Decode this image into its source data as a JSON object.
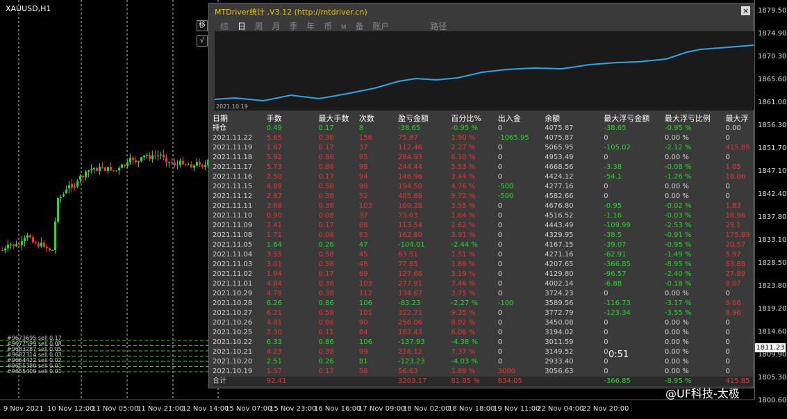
{
  "window": {
    "symbol": "XAUUSD,H1"
  },
  "chart_buttons": [
    "移",
    "√"
  ],
  "price_axis": [
    "1879.50",
    "1874.90",
    "1870.30",
    "1865.60",
    "1861.00",
    "1856.30",
    "1851.70",
    "1847.10",
    "1842.40",
    "1837.80",
    "1833.10",
    "1828.50",
    "1823.80",
    "1819.20",
    "1814.60",
    "1809.90",
    "1805.30",
    "1800.60"
  ],
  "current_price": "1811.23",
  "time_axis": [
    "9 Nov 2021",
    "10 Nov 12:00",
    "11 Nov 05:00",
    "11 Nov 21:00",
    "12 Nov 14:00",
    "15 Nov 07:00",
    "15 Nov 23:00",
    "16 Nov 16:00",
    "17 Nov 09:00",
    "18 Nov 02:00",
    "18 Nov 18:00",
    "19 Nov 11:00",
    "22 Nov 04:00",
    "22 Nov 20:00"
  ],
  "orders": [
    "#9673695 sell 0.17",
    "#9677599 sell 0.08",
    "#9683287 sell 0.05",
    "#9682314 sell 0.03",
    "#9664422 sell 0.02",
    "#9655380 sell 0.01",
    "#9655409 sell 0.01"
  ],
  "panel": {
    "title": "MTDriver统计 ,V3.12 (http://mtdriver.cn)",
    "close": "×",
    "tabs": [
      "综",
      "日",
      "周",
      "月",
      "季",
      "年",
      "币",
      "M",
      "备",
      "账户",
      "路径"
    ],
    "active_tab": "日",
    "equity_start_date": "2021.10.19",
    "headers": [
      "日期",
      "手数",
      "最大手数",
      "次数",
      "盈亏金额",
      "百分比%",
      "出入金",
      "余额",
      "最大浮亏金额",
      "最大浮亏比例",
      "最大浮"
    ],
    "rows": [
      [
        "持仓",
        "0.49",
        "0.17",
        "8",
        "-38.65",
        "-0.95 %",
        "0",
        "4075.87",
        "-38.65",
        "-0.95 %",
        "0.00"
      ],
      [
        "2021.11.22",
        "5.65",
        "0.38",
        "156",
        "75.87",
        "1.90 %",
        "-1065.95",
        "4075.87",
        "0",
        "0.00 %",
        "0"
      ],
      [
        "2021.11.19",
        "1.67",
        "0.17",
        "37",
        "112.46",
        "2.27 %",
        "0",
        "5065.95",
        "-105.02",
        "-2.12 %",
        "415.85"
      ],
      [
        "2021.11.18",
        "5.92",
        "0.86",
        "85",
        "284.93",
        "6.10 %",
        "0",
        "4953.49",
        "0",
        "0.00 %",
        "0"
      ],
      [
        "2021.11.17",
        "5.73",
        "0.86",
        "98",
        "244.44",
        "5.53 %",
        "0",
        "4668.56",
        "-3.38",
        "-0.08 %",
        "1.05"
      ],
      [
        "2021.11.16",
        "2.50",
        "0.17",
        "94",
        "146.96",
        "3.44 %",
        "0",
        "4424.12",
        "-54.1",
        "-1.26 %",
        "18.06"
      ],
      [
        "2021.11.15",
        "4.89",
        "0.58",
        "98",
        "194.50",
        "4.76 %",
        "-500",
        "4277.16",
        "0",
        "0.00 %",
        "0"
      ],
      [
        "2021.11.12",
        "2.87",
        "0.38",
        "52",
        "405.86",
        "9.72 %",
        "-500",
        "4582.66",
        "0",
        "0.00 %",
        "0"
      ],
      [
        "2021.11.11",
        "3.68",
        "0.38",
        "103",
        "160.28",
        "3.55 %",
        "0",
        "4676.80",
        "-0.95",
        "-0.02 %",
        "1.83"
      ],
      [
        "2021.11.10",
        "0.90",
        "0.08",
        "37",
        "73.03",
        "1.64 %",
        "0",
        "4516.52",
        "-1.16",
        "-0.03 %",
        "18.96"
      ],
      [
        "2021.11.09",
        "2.41",
        "0.17",
        "88",
        "113.54",
        "2.62 %",
        "0",
        "4443.49",
        "-109.99",
        "-2.53 %",
        "25.1"
      ],
      [
        "2021.11.08",
        "1.71",
        "0.08",
        "83",
        "162.80",
        "3.91 %",
        "0",
        "4329.95",
        "-38.5",
        "-0.91 %",
        "175.89"
      ],
      [
        "2021.11.05",
        "1.64",
        "0.26",
        "47",
        "-104.01",
        "-2.44 %",
        "0",
        "4167.15",
        "-39.07",
        "-0.95 %",
        "20.57"
      ],
      [
        "2021.11.04",
        "3.55",
        "0.58",
        "45",
        "63.51",
        "1.51 %",
        "0",
        "4271.16",
        "-62.91",
        "-1.49 %",
        "5.97"
      ],
      [
        "2021.11.03",
        "3.01",
        "0.58",
        "48",
        "77.85",
        "1.89 %",
        "0",
        "4207.65",
        "-366.85",
        "-8.95 %",
        "63.88"
      ],
      [
        "2021.11.02",
        "1.94",
        "0.17",
        "69",
        "127.66",
        "3.19 %",
        "0",
        "4129.80",
        "-96.57",
        "-2.40 %",
        "27.89"
      ],
      [
        "2021.11.01",
        "4.84",
        "0.38",
        "103",
        "277.91",
        "7.46 %",
        "0",
        "4002.14",
        "-6.88",
        "-0.18 %",
        "8.07"
      ],
      [
        "2021.10.29",
        "4.79",
        "0.38",
        "112",
        "134.67",
        "3.75 %",
        "0",
        "3724.23",
        "0",
        "0.00 %",
        "0"
      ],
      [
        "2021.10.28",
        "6.26",
        "0.86",
        "106",
        "-83.23",
        "-2.27 %",
        "-100",
        "3589.56",
        "-116.73",
        "-3.17 %",
        "9.66"
      ],
      [
        "2021.10.27",
        "6.21",
        "0.58",
        "101",
        "322.71",
        "9.35 %",
        "0",
        "3772.79",
        "-123.34",
        "-3.55 %",
        "8.96"
      ],
      [
        "2021.10.26",
        "4.81",
        "0.86",
        "90",
        "256.06",
        "8.02 %",
        "0",
        "3450.08",
        "0",
        "0.00 %",
        "0"
      ],
      [
        "2021.10.25",
        "2.30",
        "0.11",
        "84",
        "182.43",
        "6.06 %",
        "0",
        "3194.02",
        "0",
        "0.00 %",
        "0"
      ],
      [
        "2021.10.22",
        "6.33",
        "0.86",
        "106",
        "-137.93",
        "-4.38 %",
        "0",
        "3011.59",
        "0",
        "0.00 %",
        "0"
      ],
      [
        "2021.10.21",
        "4.23",
        "0.38",
        "99",
        "216.12",
        "7.37 %",
        "0",
        "3149.52",
        "0",
        "0.00 %",
        "0"
      ],
      [
        "2021.10.20",
        "2.51",
        "0.26",
        "81",
        "-123.23",
        "-4.03 %",
        "0",
        "2933.40",
        "0",
        "0.00 %",
        "0"
      ],
      [
        "2021.10.19",
        "1.57",
        "0.17",
        "58",
        "56.63",
        "1.89 %",
        "3000",
        "3056.63",
        "0",
        "0.00 %",
        "0"
      ]
    ],
    "totals": [
      "合计",
      "92.41",
      "",
      "",
      "3203.17",
      "81.85 %",
      "834.05",
      "",
      "-366.85",
      "-8.95 %",
      "415.85"
    ]
  },
  "timer": "0:51",
  "watermark": "@UF科技-太极",
  "colors": {
    "positive": "#22dd22",
    "negative": "#ee3333",
    "equity_line": "#2aa8e8",
    "title": "#f0c000"
  }
}
